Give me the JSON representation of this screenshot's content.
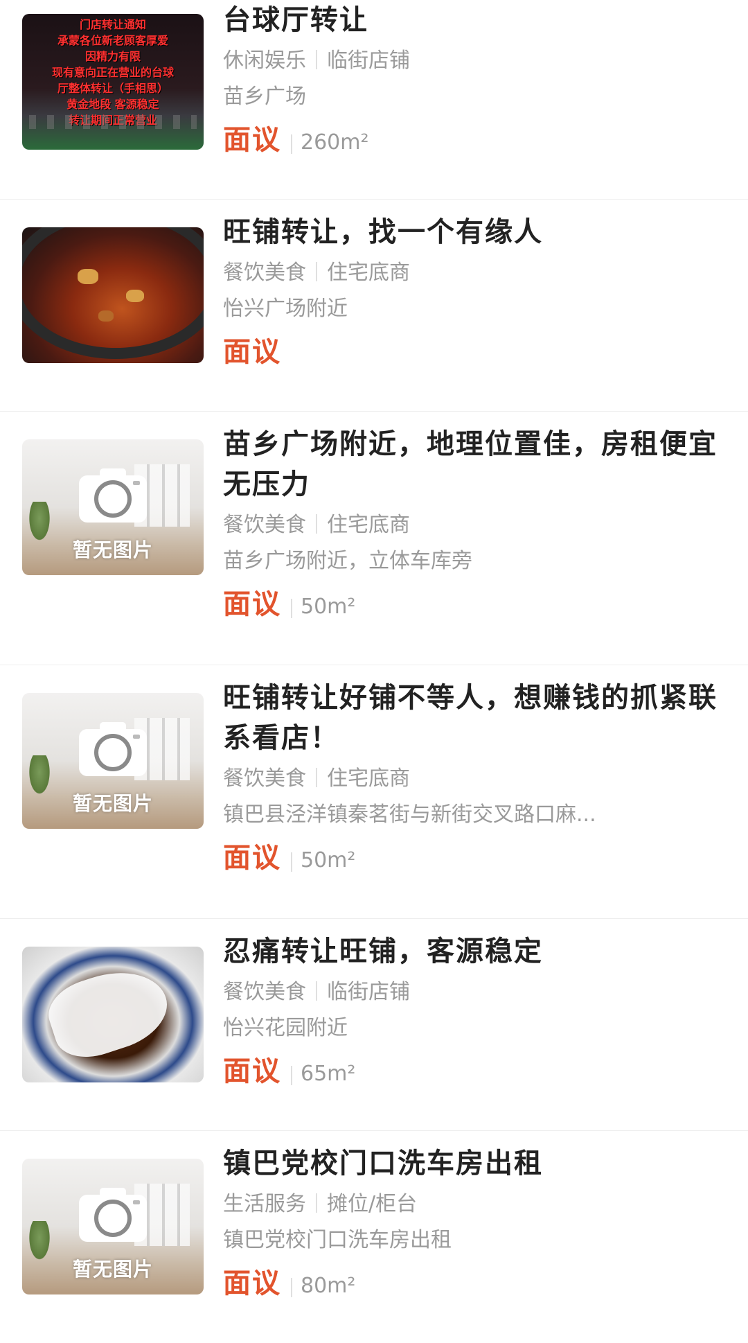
{
  "listings": [
    {
      "title": "台球厅转让",
      "category": "休闲娱乐",
      "shop_type": "临街店铺",
      "address": "苗乡广场",
      "price": "面议",
      "area": "260m²",
      "thumb": "billiard-photo",
      "thumb_text": [
        "门店转让通知",
        "承蒙各位新老顾客厚爱",
        "因精力有限",
        "现有意向正在营业的台球",
        "厅整体转让（手相思）",
        "黄金地段  客源稳定",
        "转让期间正常营业"
      ]
    },
    {
      "title": "旺铺转让，找一个有缘人",
      "category": "餐饮美食",
      "shop_type": "住宅底商",
      "address": "怡兴广场附近",
      "price": "面议",
      "area": "",
      "thumb": "hotpot-photo"
    },
    {
      "title": "苗乡广场附近，地理位置佳，房租便宜无压力",
      "category": "餐饮美食",
      "shop_type": "住宅底商",
      "address": "苗乡广场附近，立体车库旁",
      "price": "面议",
      "area": "50m²",
      "thumb": "placeholder",
      "thumb_label": "暂无图片"
    },
    {
      "title": "旺铺转让好铺不等人，想赚钱的抓紧联系看店！",
      "category": "餐饮美食",
      "shop_type": "住宅底商",
      "address": "镇巴县泾洋镇秦茗街与新街交叉路口麻...",
      "price": "面议",
      "area": "50m²",
      "thumb": "placeholder",
      "thumb_label": "暂无图片"
    },
    {
      "title": "忍痛转让旺铺，客源稳定",
      "category": "餐饮美食",
      "shop_type": "临街店铺",
      "address": "怡兴花园附近",
      "price": "面议",
      "area": "65m²",
      "thumb": "noodle-photo"
    },
    {
      "title": "镇巴党校门口洗车房出租",
      "category": "生活服务",
      "shop_type": "摊位/柜台",
      "address": "镇巴党校门口洗车房出租",
      "price": "面议",
      "area": "80m²",
      "thumb": "placeholder",
      "thumb_label": "暂无图片"
    }
  ],
  "colors": {
    "price": "#e2542d",
    "title": "#222222",
    "meta": "#9a9a9a",
    "divider": "#eeeeee"
  }
}
